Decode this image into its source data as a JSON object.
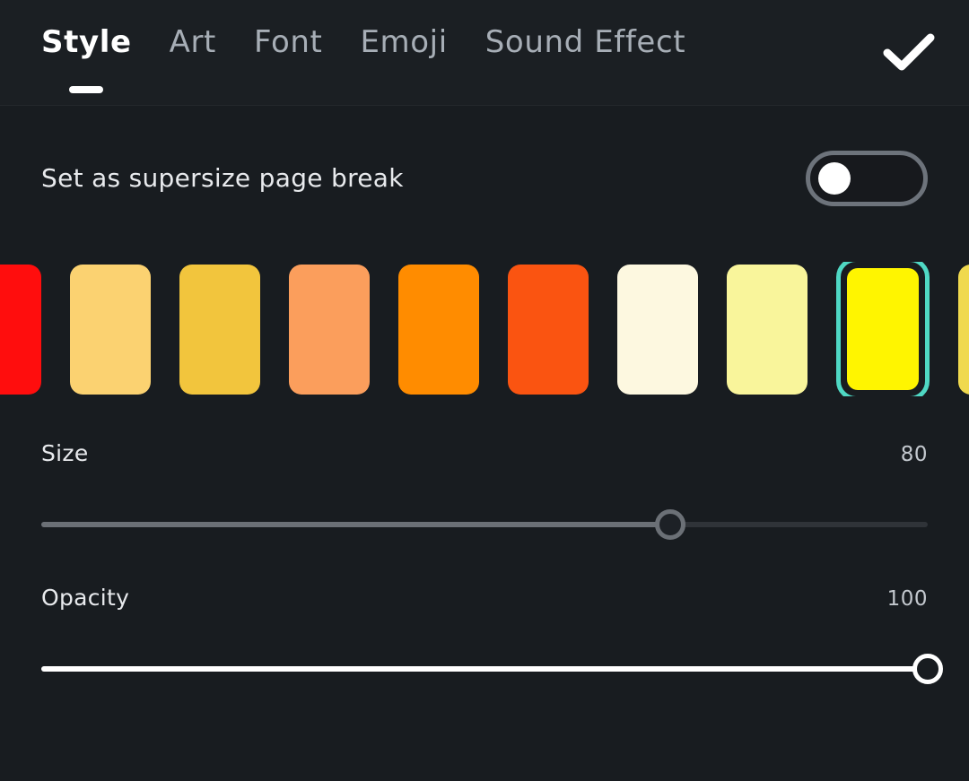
{
  "header": {
    "tabs": [
      {
        "label": "Style",
        "active": true
      },
      {
        "label": "Art",
        "active": false
      },
      {
        "label": "Font",
        "active": false
      },
      {
        "label": "Emoji",
        "active": false
      },
      {
        "label": "Sound Effect",
        "active": false
      }
    ],
    "confirm_icon": "checkmark-icon"
  },
  "toggle": {
    "label": "Set as supersize page break",
    "state": "off"
  },
  "swatches": {
    "selection_ring_color": "#4fd8c4",
    "selected_index": 8,
    "items": [
      {
        "color": "#FF0D0D",
        "clipped": "left"
      },
      {
        "color": "#FBD271",
        "clipped": ""
      },
      {
        "color": "#F2C53D",
        "clipped": ""
      },
      {
        "color": "#FB9E5C",
        "clipped": ""
      },
      {
        "color": "#FF8C00",
        "clipped": ""
      },
      {
        "color": "#FA5411",
        "clipped": ""
      },
      {
        "color": "#FDF8E0",
        "clipped": ""
      },
      {
        "color": "#F9F59B",
        "clipped": ""
      },
      {
        "color": "#FFF500",
        "clipped": ""
      },
      {
        "color": "#F0D94E",
        "clipped": "right"
      }
    ]
  },
  "sliders": [
    {
      "name": "Size",
      "value": "80",
      "percent": 71,
      "min": 0,
      "max": 100,
      "accent": "#6b7076"
    },
    {
      "name": "Opacity",
      "value": "100",
      "percent": 100,
      "min": 0,
      "max": 100,
      "accent": "#ffffff"
    }
  ],
  "theme": {
    "background": "#181c20",
    "header_background": "#1b1f23",
    "divider": "#24282c",
    "text_primary": "#ffffff",
    "text_muted": "#a7aeb6"
  }
}
